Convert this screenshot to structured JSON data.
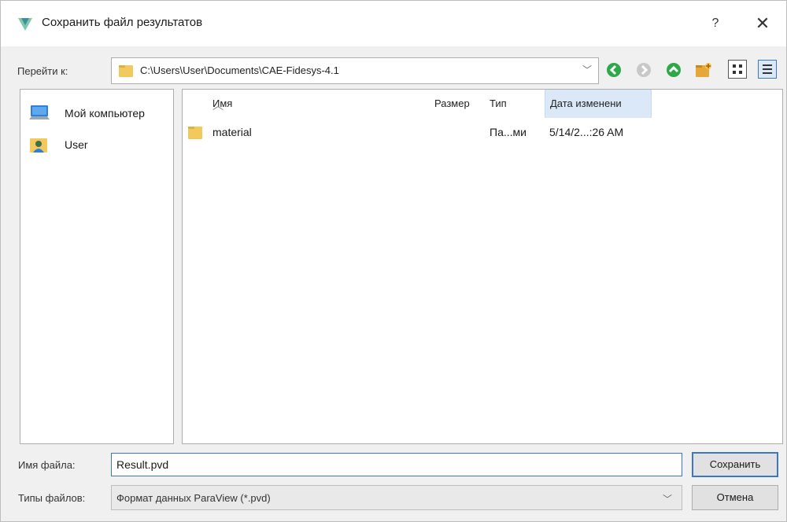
{
  "window": {
    "title": "Сохранить файл результатов",
    "help": "?",
    "close": "✕"
  },
  "path_bar": {
    "label": "Перейти к:",
    "path": "C:\\Users\\User\\Documents\\CAE-Fidesys-4.1"
  },
  "sidebar": {
    "items": [
      {
        "label": "Мой компьютер",
        "icon": "computer-icon"
      },
      {
        "label": "User",
        "icon": "user-folder-icon"
      }
    ]
  },
  "file_list": {
    "columns": [
      "Имя",
      "Размер",
      "Тип",
      "Дата изменени"
    ],
    "rows": [
      {
        "name": "material",
        "size": "",
        "type": "Па...ми",
        "date": "5/14/2...:26 AM"
      }
    ]
  },
  "file_name": {
    "label": "Имя файла:",
    "value": "Result.pvd"
  },
  "file_type": {
    "label": "Типы файлов:",
    "value": "Формат данных ParaView (*.pvd)"
  },
  "buttons": {
    "save": "Сохранить",
    "cancel": "Отмена"
  },
  "colors": {
    "accent": "#3b77c2",
    "nav_green": "#2fa84a",
    "folder": "#f2c95c"
  }
}
